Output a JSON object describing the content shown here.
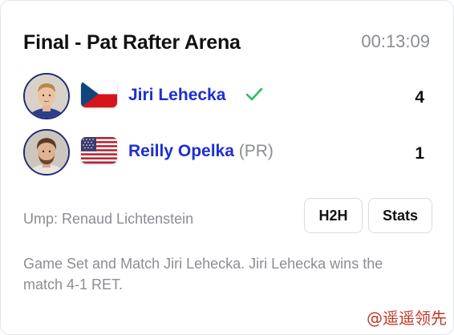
{
  "match": {
    "title": "Final - Pat Rafter Arena",
    "time": "00:13:09",
    "umpire": "Ump: Renaud Lichtenstein",
    "summary": "Game Set and Match Jiri Lehecka. Jiri Lehecka wins the match 4-1 RET."
  },
  "players": [
    {
      "name": "Jiri Lehecka",
      "seed": "",
      "score": "4",
      "winner": true,
      "flag": "czech-flag"
    },
    {
      "name": "Reilly Opelka",
      "seed": "(PR)",
      "score": "1",
      "winner": false,
      "flag": "usa-flag"
    }
  ],
  "buttons": {
    "h2h_label": "H2H",
    "stats_label": "Stats"
  },
  "watermark": "@遥遥领先",
  "colors": {
    "player_name": "#1d2fd0",
    "muted_text": "#8a8d93",
    "winner_check": "#2ebd59",
    "avatar_border": "#1e2a78"
  }
}
